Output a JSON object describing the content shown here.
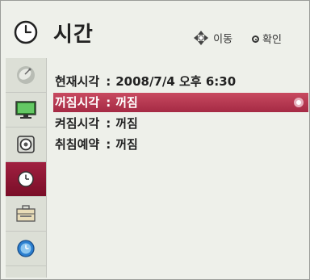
{
  "header": {
    "title": "시간",
    "hint_move": "이동",
    "hint_ok": "확인"
  },
  "sidebar": {
    "items": [
      {
        "icon": "satellite-dish-icon"
      },
      {
        "icon": "screen-icon"
      },
      {
        "icon": "speaker-icon"
      },
      {
        "icon": "clock-icon",
        "selected": true
      },
      {
        "icon": "toolbox-icon"
      },
      {
        "icon": "globe-clock-icon"
      }
    ]
  },
  "settings": {
    "rows": [
      {
        "label": "현재시각",
        "sep": ":",
        "value": "2008/7/4 오후 6:30"
      },
      {
        "label": "꺼짐시각",
        "sep": ":",
        "value": "꺼짐"
      },
      {
        "label": "켜짐시각",
        "sep": ":",
        "value": "꺼짐"
      },
      {
        "label": "취침예약",
        "sep": ":",
        "value": "꺼짐"
      }
    ]
  },
  "colors": {
    "highlight": "#b8354f",
    "sidebar_selected": "#8c1631"
  }
}
